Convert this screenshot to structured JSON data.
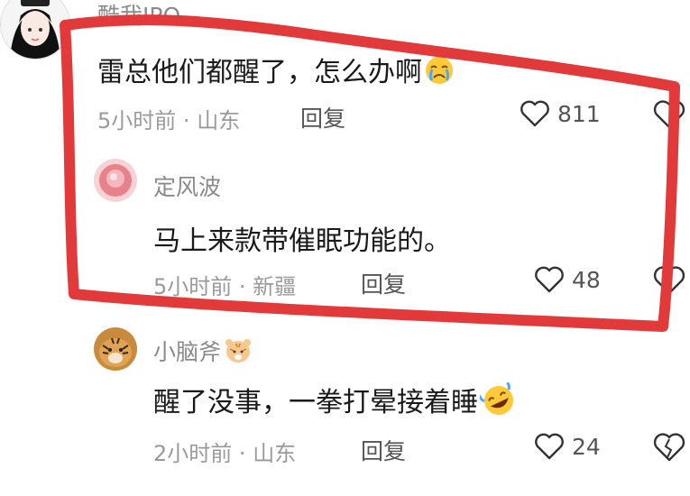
{
  "comments": [
    {
      "username": "酷我IPO",
      "text": "雷总他们都醒了，怎么办啊",
      "time": "5小时前",
      "location": "山东",
      "reply_label": "回复",
      "likes": "811",
      "emoji": "crying-face"
    },
    {
      "username": "定风波",
      "text": "马上来款带催眠功能的。",
      "time": "5小时前",
      "location": "新疆",
      "reply_label": "回复",
      "likes": "48"
    },
    {
      "username": "小脑斧",
      "text": "醒了没事，一拳打晕接着睡",
      "time": "2小时前",
      "location": "山东",
      "reply_label": "回复",
      "likes": "24",
      "emoji": "rolling-on-floor-laughing",
      "badge": "tiger-face"
    }
  ],
  "separator": "·",
  "colors": {
    "annotation_red": "#e23a3a",
    "meta_gray": "#9a9a9a",
    "text_dark": "#1a1a1a"
  }
}
